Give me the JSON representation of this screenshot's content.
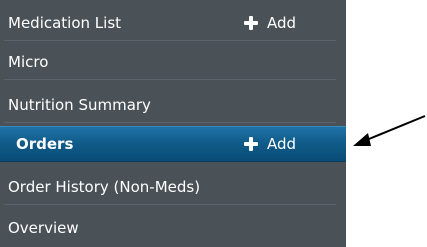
{
  "menu": {
    "items": [
      {
        "label": "Medication List",
        "add_label": "Add",
        "selected": false
      },
      {
        "label": "Micro",
        "selected": false
      },
      {
        "label": "Nutrition Summary",
        "selected": false
      },
      {
        "label": "Orders",
        "add_label": "Add",
        "selected": true
      },
      {
        "label": "Order History (Non-Meds)",
        "selected": false
      },
      {
        "label": "Overview",
        "selected": false
      }
    ]
  },
  "colors": {
    "menu_bg": "#4a5157",
    "selected_bg": "#0f5a88",
    "text": "#ffffff"
  },
  "annotation": {
    "arrow_icon": "pointer-arrow-icon"
  }
}
